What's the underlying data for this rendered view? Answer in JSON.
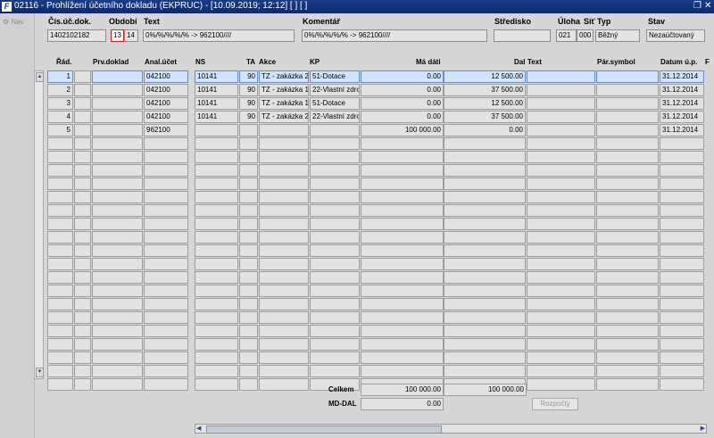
{
  "titlebar": {
    "title": "02116 - Prohlížení účetního dokladu (EKPRUC) - [10.09.2019; 12:12]  [ ]  [ ]",
    "logo": "F",
    "restore_icon": "restore-icon",
    "close_icon": "close-icon"
  },
  "nav": {
    "label": "Nav"
  },
  "header": {
    "labels": {
      "doc": "Čís.úč.dok.",
      "period": "Období",
      "text": "Text",
      "comment": "Komentář",
      "center": "Středisko",
      "task": "Úloha",
      "net": "Síť",
      "type": "Typ",
      "state": "Stav"
    },
    "values": {
      "doc": "1402102182",
      "period1": "13",
      "period2": "14",
      "text": "0%/%/%/%/% -> 962100////",
      "comment": "0%/%/%/%/% -> 962100////",
      "center": "",
      "task": "021",
      "net": "000",
      "type": "Běžný",
      "state": "Nezaúčtovaný"
    }
  },
  "table": {
    "headers": {
      "rad": "Řád.",
      "prv": "Prv.doklad",
      "anal": "Anal.účet",
      "ns": "NS",
      "ta": "TA",
      "akce": "Akce",
      "kp": "KP",
      "madati": "Má dáti",
      "dal": "Dal",
      "text": "Text",
      "par": "Pár.symbol",
      "datum": "Datum ú.p.",
      "extra": "F"
    },
    "rows": [
      {
        "rad": "1",
        "prv": "",
        "anal": "042100",
        "ns": "10141",
        "ta": "90",
        "akce": "TZ - zakázka 2",
        "kp": "51-Dotace",
        "madati": "0.00",
        "dal": "12 500.00",
        "text": "",
        "par": "",
        "datum": "31.12.2014"
      },
      {
        "rad": "2",
        "prv": "",
        "anal": "042100",
        "ns": "10141",
        "ta": "90",
        "akce": "TZ - zakázka 1",
        "kp": "22-Vlastní zdro",
        "madati": "0.00",
        "dal": "37 500.00",
        "text": "",
        "par": "",
        "datum": "31.12.2014"
      },
      {
        "rad": "3",
        "prv": "",
        "anal": "042100",
        "ns": "10141",
        "ta": "90",
        "akce": "TZ - zakázka 1",
        "kp": "51-Dotace",
        "madati": "0.00",
        "dal": "12 500.00",
        "text": "",
        "par": "",
        "datum": "31.12.2014"
      },
      {
        "rad": "4",
        "prv": "",
        "anal": "042100",
        "ns": "10141",
        "ta": "90",
        "akce": "TZ - zakázka 2",
        "kp": "22-Vlastní zdro",
        "madati": "0.00",
        "dal": "37 500.00",
        "text": "",
        "par": "",
        "datum": "31.12.2014"
      },
      {
        "rad": "5",
        "prv": "",
        "anal": "962100",
        "ns": "",
        "ta": "",
        "akce": "",
        "kp": "",
        "madati": "100 000.00",
        "dal": "0.00",
        "text": "",
        "par": "",
        "datum": "31.12.2014"
      }
    ],
    "empty_rows": 19
  },
  "totals": {
    "celkem_label": "Celkem",
    "celkem_md": "100 000.00",
    "celkem_dal": "100 000.00",
    "mddal_label": "MD-DAL",
    "mddal_value": "0.00"
  },
  "buttons": {
    "rozpocty": "Rozpočty"
  }
}
